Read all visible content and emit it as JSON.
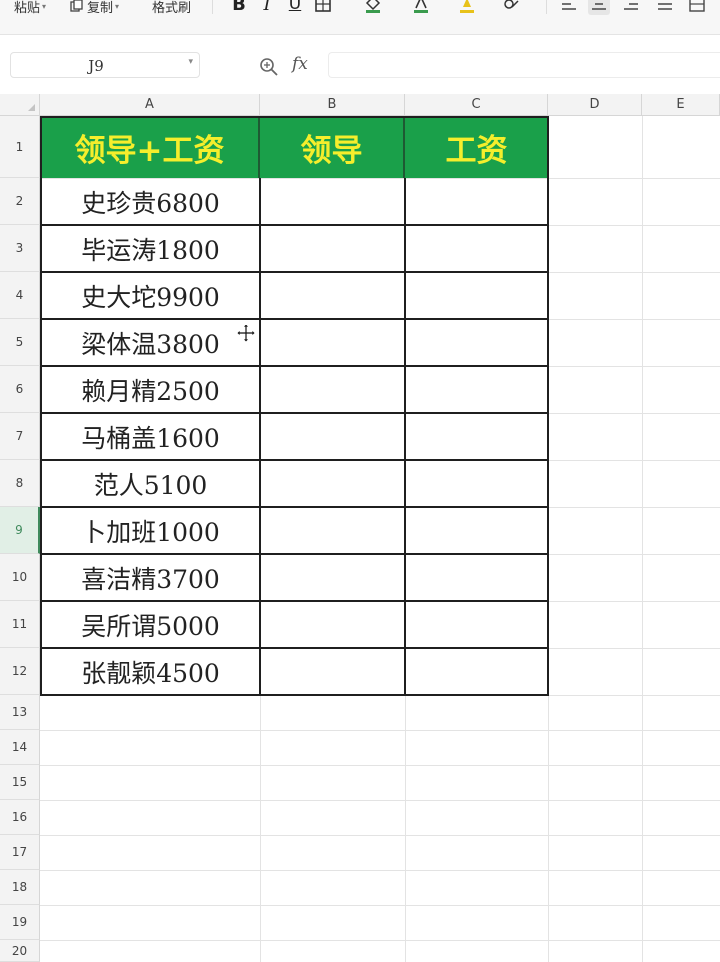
{
  "toolbar": {
    "paste_label": "粘贴",
    "copy_label": "复制",
    "format_painter_label": "格式刷",
    "bold_label": "B",
    "italic_label": "I",
    "underline_label": "U"
  },
  "formula_bar": {
    "cell_reference": "J9",
    "fx_label": "fx",
    "formula_value": ""
  },
  "columns": [
    "A",
    "B",
    "C",
    "D",
    "E"
  ],
  "rows": [
    "1",
    "2",
    "3",
    "4",
    "5",
    "6",
    "7",
    "8",
    "9",
    "10",
    "11",
    "12",
    "13",
    "14",
    "15",
    "16",
    "17",
    "18",
    "19",
    "20"
  ],
  "active_row": "9",
  "table": {
    "headers": [
      "领导+工资",
      "领导",
      "工资"
    ],
    "data": [
      "史珍贵6800",
      "毕运涛1800",
      "史大坨9900",
      "梁体温3800",
      "赖月精2500",
      "马桶盖1600",
      "范人5100",
      "卜加班1000",
      "喜洁精3700",
      "吴所谓5000",
      "张靓颖4500"
    ]
  },
  "colors": {
    "header_fill": "#1aa04a",
    "header_text": "#f5ee2c",
    "active_row_accent": "#3f8a5c"
  },
  "icons": [
    "bold-icon",
    "italic-icon",
    "underline-icon",
    "border-icon",
    "fill-color-icon",
    "font-color-icon",
    "clear-format-icon",
    "align-left-icon",
    "align-center-icon",
    "align-right-icon",
    "justify-icon",
    "wrap-icon",
    "zoom-icon",
    "move-cursor-icon"
  ]
}
